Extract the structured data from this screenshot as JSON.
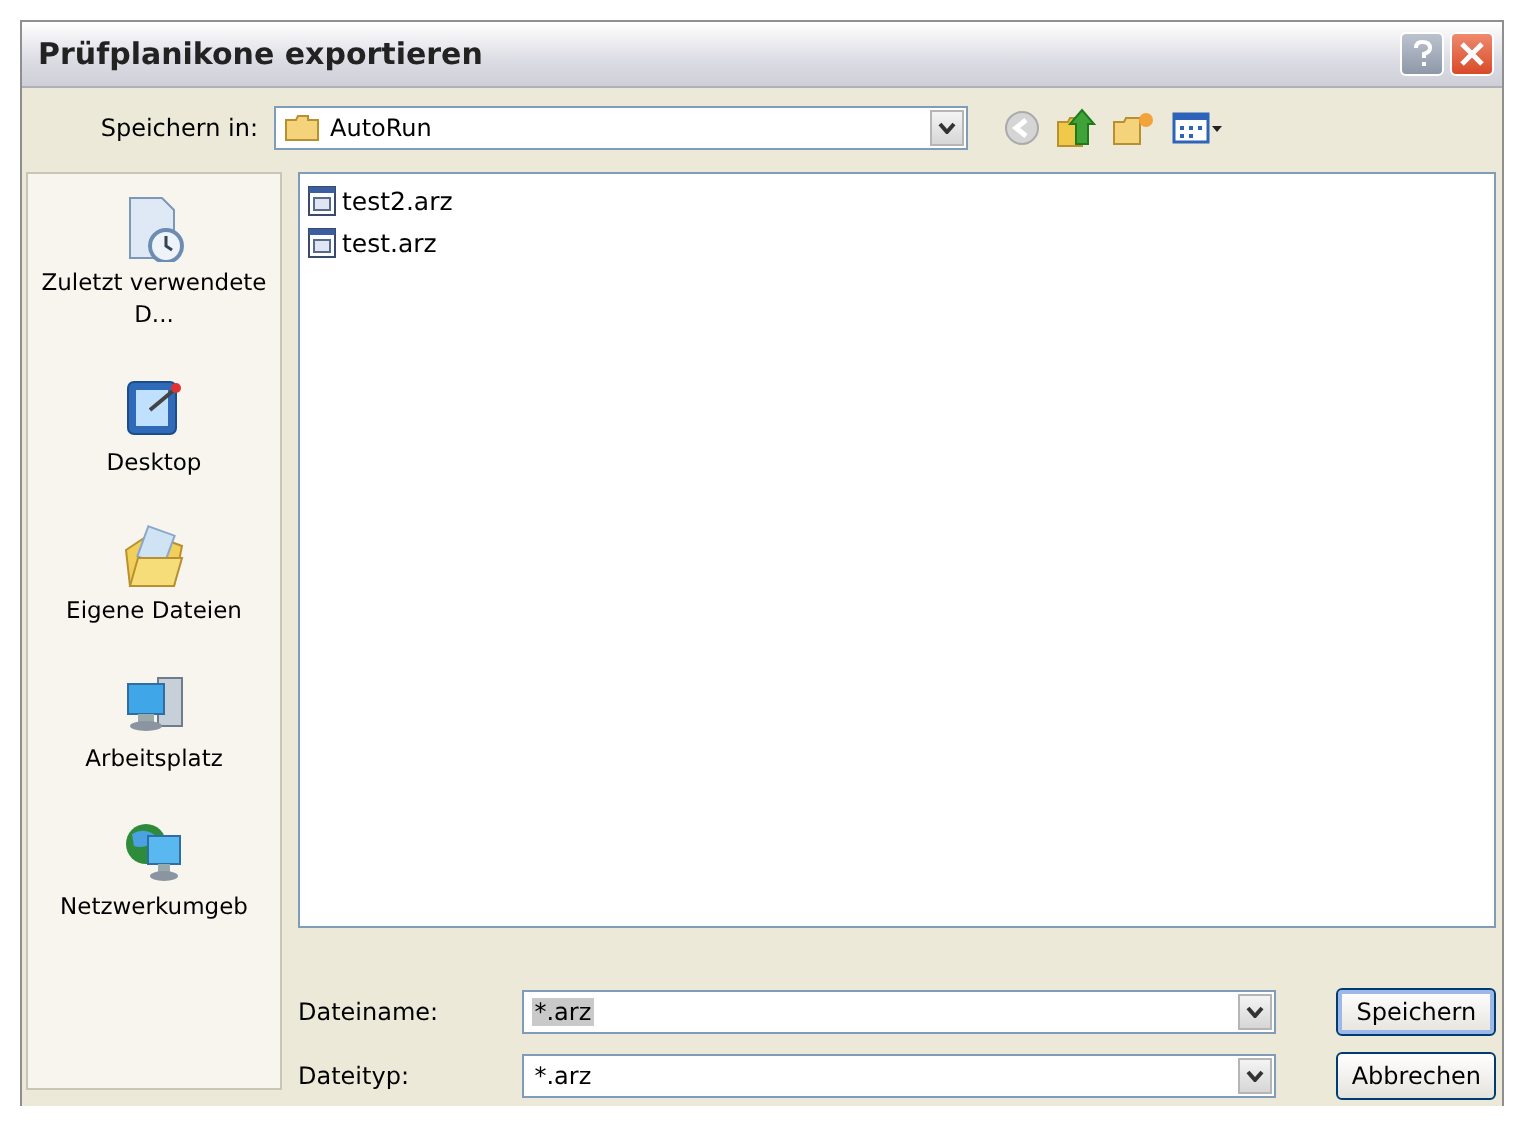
{
  "window": {
    "title": "Prüfplanikone exportieren"
  },
  "save_in": {
    "label": "Speichern in:",
    "value": "AutoRun"
  },
  "places": [
    {
      "kind": "recent",
      "label": "Zuletzt verwendete D...",
      "selected": false
    },
    {
      "kind": "desktop",
      "label": "Desktop",
      "selected": false
    },
    {
      "kind": "documents",
      "label": "Eigene Dateien",
      "selected": false
    },
    {
      "kind": "computer",
      "label": "Arbeitsplatz",
      "selected": false
    },
    {
      "kind": "network",
      "label": "Netzwerkumgeb",
      "selected": false
    }
  ],
  "files": [
    {
      "name": "test2.arz",
      "selected": false
    },
    {
      "name": "test.arz",
      "selected": false
    }
  ],
  "file_name": {
    "label": "Dateiname:",
    "value": "*.arz",
    "highlighted": true
  },
  "file_type": {
    "label": "Dateityp:",
    "value": "*.arz"
  },
  "buttons": [
    {
      "label": "Speichern",
      "default": true
    },
    {
      "label": "Abbrechen",
      "default": false
    }
  ]
}
